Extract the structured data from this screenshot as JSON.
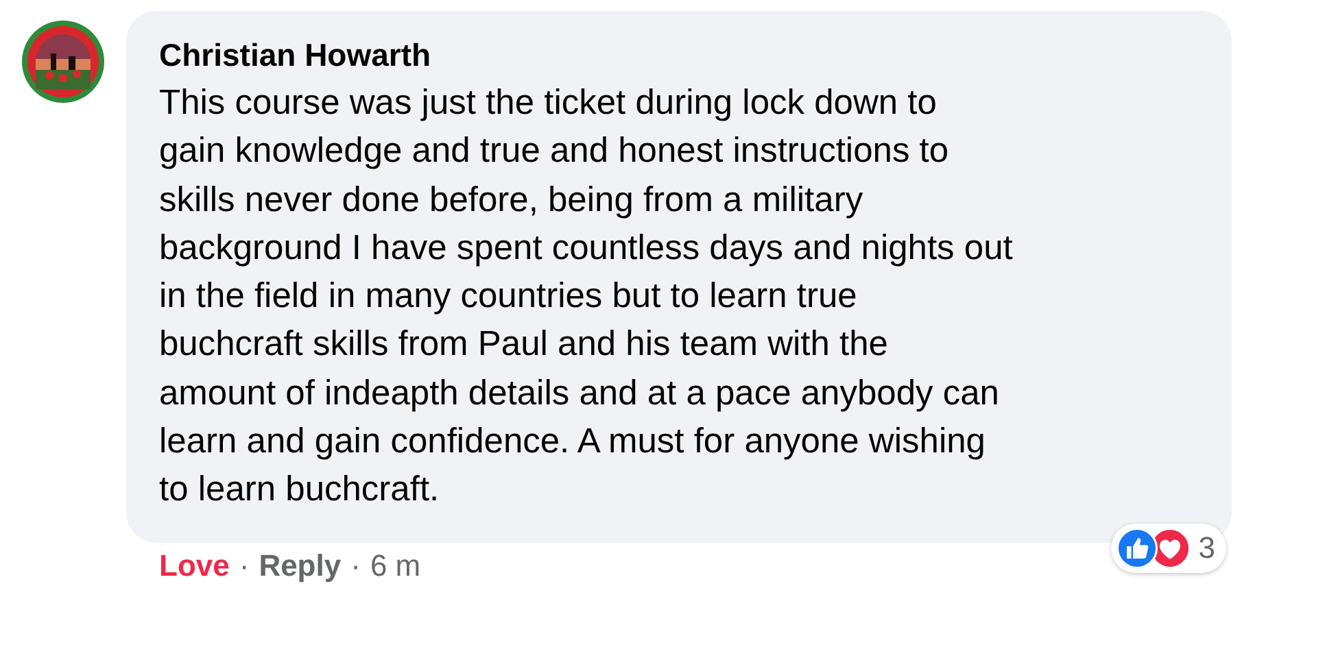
{
  "comment": {
    "author": "Christian Howarth",
    "text": "This course was just the ticket during lock down to\ngain knowledge and true and honest instructions to\nskills never done before, being from a military\nbackground I have spent countless days and nights out\nin the field in many countries but to learn true\nbuchcraft skills from Paul and his team with the\namount of indeapth details and at a pace anybody can\nlearn and gain confidence. A must for anyone wishing\nto learn buchcraft.",
    "reactions": {
      "types": [
        {
          "kind": "like"
        },
        {
          "kind": "love"
        }
      ],
      "count": "3"
    }
  },
  "actions": [
    {
      "label": "Love",
      "selected": true
    },
    {
      "label": "Reply",
      "selected": false
    }
  ],
  "separator": "·",
  "time": "6 m"
}
